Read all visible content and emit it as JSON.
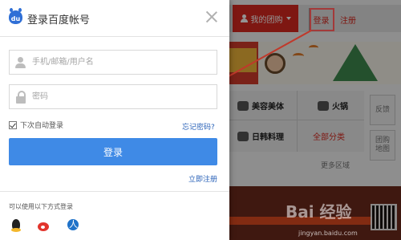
{
  "dialog": {
    "title": "登录百度帐号",
    "username_placeholder": "手机/邮箱/用户名",
    "password_placeholder": "密码",
    "remember_label": "下次自动登录",
    "remember_checked": true,
    "forgot_label": "忘记密码?",
    "login_label": "登录",
    "register_label": "立即注册",
    "other_methods_label": "可以使用以下方式登录",
    "social_icons": [
      "qq-icon",
      "weibo-icon",
      "renren-icon"
    ]
  },
  "site": {
    "my_group_label": "我的团购",
    "login_label": "登录",
    "register_label": "注册",
    "categories": [
      "美容美体",
      "火锅",
      "日韩料理",
      "全部分类"
    ],
    "more_areas": "更多区域",
    "side_buttons": [
      "反馈",
      "团购地图"
    ]
  },
  "watermark": {
    "text": "Bai 经验",
    "sub": "jingyan.baidu.com"
  },
  "colors": {
    "brand_red": "#d9291f",
    "login_blue": "#3f8ae6",
    "link_blue": "#2a62b8",
    "annotation": "#c0392b"
  }
}
